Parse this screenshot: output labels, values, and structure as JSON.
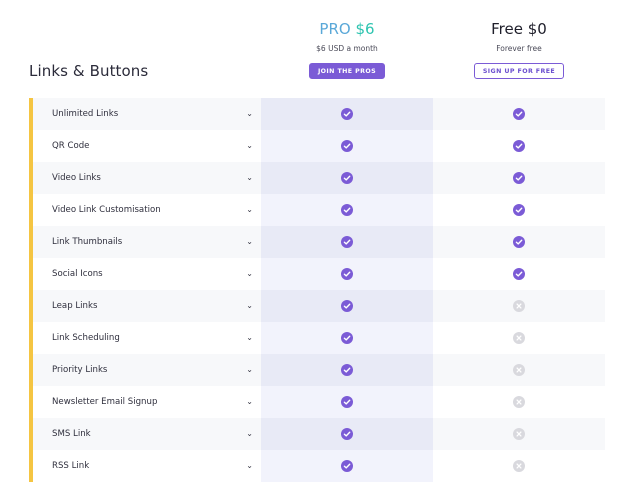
{
  "section_title": "Links & Buttons",
  "plans": {
    "pro": {
      "name": "PRO",
      "price": "$6",
      "subtitle": "$6 USD a month",
      "button": "JOIN THE PROS"
    },
    "free": {
      "name": "Free",
      "price": "$0",
      "subtitle": "Forever free",
      "button": "SIGN UP FOR FREE"
    }
  },
  "colors": {
    "accent": "#f5c542",
    "check": "#7b5bd6",
    "cross": "#d9d9de"
  },
  "features": [
    {
      "label": "Unlimited Links",
      "pro": true,
      "free": true
    },
    {
      "label": "QR Code",
      "pro": true,
      "free": true
    },
    {
      "label": "Video Links",
      "pro": true,
      "free": true
    },
    {
      "label": "Video Link Customisation",
      "pro": true,
      "free": true
    },
    {
      "label": "Link Thumbnails",
      "pro": true,
      "free": true
    },
    {
      "label": "Social Icons",
      "pro": true,
      "free": true
    },
    {
      "label": "Leap Links",
      "pro": true,
      "free": false
    },
    {
      "label": "Link Scheduling",
      "pro": true,
      "free": false
    },
    {
      "label": "Priority Links",
      "pro": true,
      "free": false
    },
    {
      "label": "Newsletter Email Signup",
      "pro": true,
      "free": false
    },
    {
      "label": "SMS Link",
      "pro": true,
      "free": false
    },
    {
      "label": "RSS Link",
      "pro": true,
      "free": false
    }
  ]
}
